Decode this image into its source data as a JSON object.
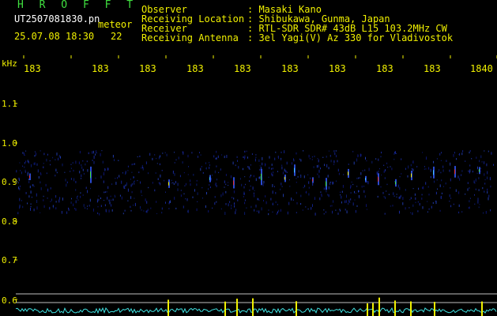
{
  "header": {
    "title": "H R O F F T",
    "filename": "UT2507081830.pn",
    "type_label": "meteor",
    "date_time": "25.07.08 18:30",
    "count": "22",
    "observer_label": "Observer",
    "observer_value": ": Masaki Kano",
    "location_label": "Receiving Location",
    "location_value": ": Shibukawa, Gunma, Japan",
    "receiver_label": "Receiver",
    "receiver_value": ": RTL-SDR SDR# 43dB L15 103.2MHz CW",
    "antenna_label": "Receiving Antenna",
    "antenna_value": ": 3el Yagi(V) Az 330 for Vladivostok"
  },
  "spectrogram": {
    "y_unit": "kHz",
    "y_ticks": [
      "1.1",
      "1.0",
      "0.9",
      "0.8",
      "0.7",
      "0.6"
    ],
    "x_ticks": [
      "183",
      "183",
      "183",
      "183",
      "183",
      "183",
      "183",
      "183",
      "183",
      "1840"
    ],
    "colors": {
      "text": "#f0f000",
      "title": "#40e040",
      "echo_base": "#1a2a9a",
      "trace": "#40e0e0"
    }
  }
}
